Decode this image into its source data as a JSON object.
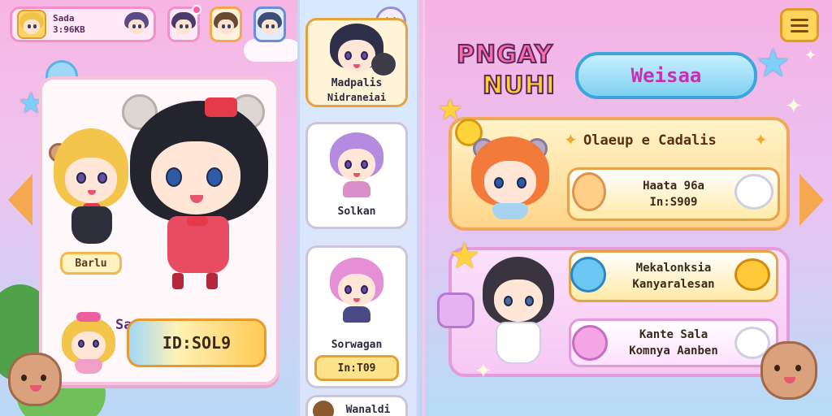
{
  "profile": {
    "name": "Sada",
    "id_code": "3:96KB"
  },
  "left_panel": {
    "left_char_name": "Barlu",
    "featured_name": "Sarna",
    "featured_id": "ID:SOL9"
  },
  "list": {
    "items": [
      {
        "line1": "Madpalis",
        "line2": "Nidraneiai"
      },
      {
        "line1": "Solkan"
      },
      {
        "line1": "Sorwagan",
        "line2": "In:T09"
      },
      {
        "line1": "Wanaldi"
      }
    ]
  },
  "right_panel": {
    "logo_line1": "PNGAY",
    "logo_line2": "NUHI",
    "title_button": "Weisaa",
    "card1": {
      "headline": "Olaeup e Cadalis",
      "row1_line1": "Haata 96a",
      "row1_line2": "In:S909"
    },
    "card2": {
      "row1_line1": "Mekalonksia",
      "row1_line2": "Kanyaralesan",
      "row2_line1": "Kante Sala",
      "row2_line2": "Komnya Aanben"
    }
  },
  "colors": {
    "accent_orange": "#f5a84f",
    "accent_pink": "#f58fcb",
    "accent_blue": "#3aa6dc"
  }
}
